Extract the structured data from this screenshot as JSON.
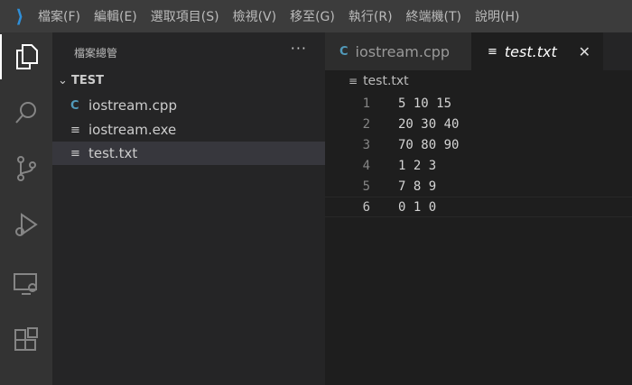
{
  "menu": [
    "檔案(F)",
    "編輯(E)",
    "選取項目(S)",
    "檢視(V)",
    "移至(G)",
    "執行(R)",
    "終端機(T)",
    "說明(H)"
  ],
  "sidebar": {
    "title": "檔案總管",
    "more": "···",
    "folder": "TEST",
    "files": [
      {
        "name": "iostream.cpp",
        "icon": "C"
      },
      {
        "name": "iostream.exe",
        "icon": "≡"
      },
      {
        "name": "test.txt",
        "icon": "≡"
      }
    ]
  },
  "tabs": [
    {
      "label": "iostream.cpp",
      "icon": "C"
    },
    {
      "label": "test.txt",
      "icon": "≡",
      "close": "✕"
    }
  ],
  "breadcrumb": {
    "icon": "≡",
    "label": "test.txt"
  },
  "lines": [
    {
      "n": "1",
      "t": "5 10 15"
    },
    {
      "n": "2",
      "t": "20 30 40"
    },
    {
      "n": "3",
      "t": "70 80 90"
    },
    {
      "n": "4",
      "t": "1 2 3"
    },
    {
      "n": "5",
      "t": "7 8 9"
    },
    {
      "n": "6",
      "t": "0 1 0"
    }
  ]
}
